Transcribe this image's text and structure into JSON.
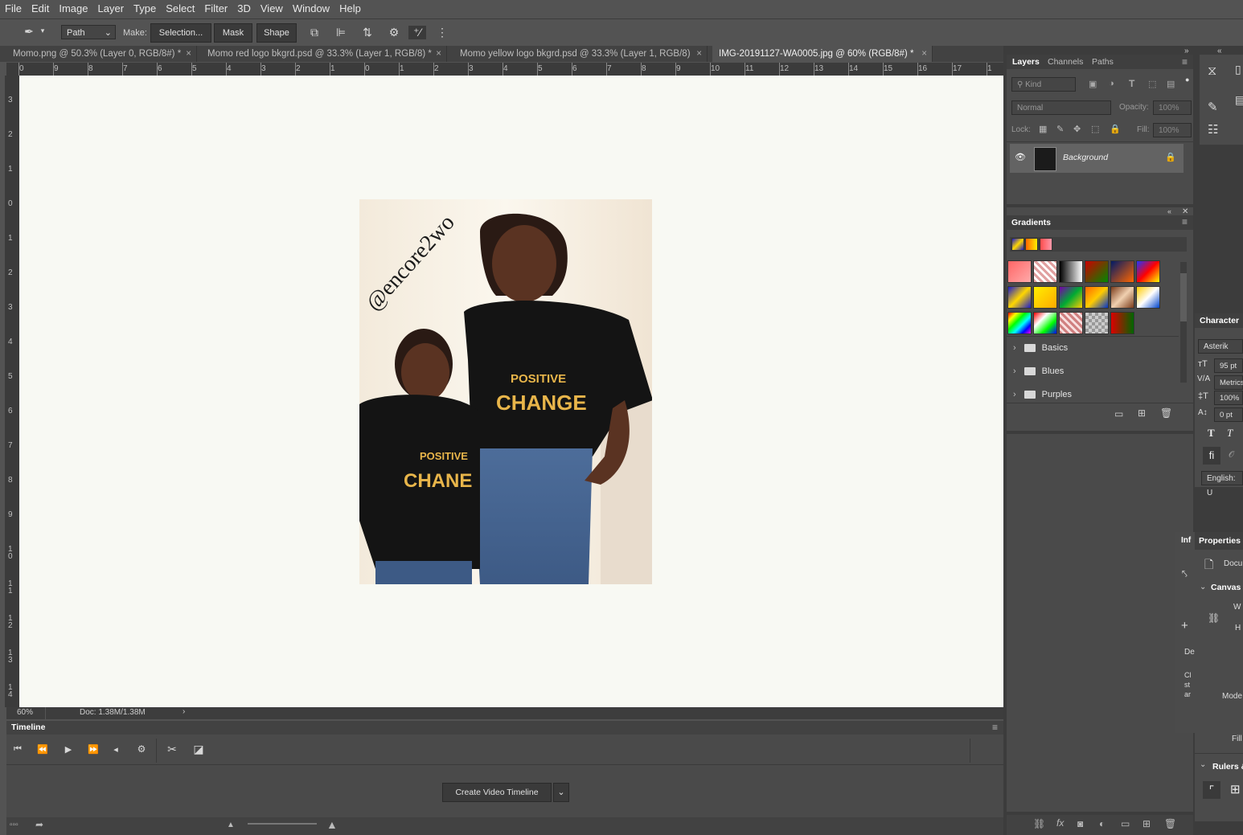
{
  "menu": [
    "File",
    "Edit",
    "Image",
    "Layer",
    "Type",
    "Select",
    "Filter",
    "3D",
    "View",
    "Window",
    "Help"
  ],
  "options": {
    "mode_value": "Path",
    "make_label": "Make:",
    "selection_button": "Selection...",
    "mask_button": "Mask",
    "shape_button": "Shape"
  },
  "tabs": [
    {
      "label": "Momo.png @ 50.3% (Layer 0, RGB/8#) *"
    },
    {
      "label": "Momo red logo bkgrd.psd @ 33.3% (Layer 1, RGB/8) *"
    },
    {
      "label": "Momo yellow logo bkgrd.psd @ 33.3% (Layer 1, RGB/8)"
    },
    {
      "label": "IMG-20191127-WA0005.jpg @ 60% (RGB/8#) *"
    }
  ],
  "ruler_h": [
    "0",
    "9",
    "8",
    "7",
    "6",
    "5",
    "4",
    "3",
    "2",
    "1",
    "0",
    "1",
    "2",
    "3",
    "4",
    "5",
    "6",
    "7",
    "8",
    "9",
    "10",
    "11",
    "12",
    "13",
    "14",
    "15",
    "16",
    "17",
    "1"
  ],
  "ruler_v": [
    "3",
    "2",
    "1",
    "0",
    "1",
    "2",
    "3",
    "4",
    "5",
    "6",
    "7",
    "8",
    "9",
    "1 0",
    "1 1",
    "1 2",
    "1 3",
    "1 4"
  ],
  "image": {
    "watermark": "@encore2wo",
    "shirt_text_1": "POSITIVE",
    "shirt_text_2": "CHANGE",
    "shirt_small_1": "POSITIVE",
    "shirt_small_2": "CHANE"
  },
  "status": {
    "zoom": "60%",
    "doc": "Doc: 1.38M/1.38M"
  },
  "timeline": {
    "title": "Timeline",
    "create_button": "Create Video Timeline"
  },
  "layers_panel": {
    "tabs": [
      "Layers",
      "Channels",
      "Paths"
    ],
    "kind_placeholder": "Kind",
    "blend_mode": "Normal",
    "opacity_label": "Opacity:",
    "opacity_value": "100%",
    "lock_label": "Lock:",
    "fill_label": "Fill:",
    "fill_value": "100%",
    "layer_name": "Background"
  },
  "gradients_panel": {
    "title": "Gradients",
    "folders": [
      "Basics",
      "Blues",
      "Purples"
    ]
  },
  "character_panel": {
    "title": "Character",
    "font": "Asterik",
    "size": "95 pt",
    "kerning": "Metrics",
    "vscale": "100%",
    "baseline": "0 pt",
    "language": "English: U"
  },
  "properties_panel": {
    "info_tab": "Inf",
    "title": "Properties",
    "doc_label": "Docu",
    "canvas_section": "Canvas",
    "w": "W",
    "h": "H",
    "mode": "Mode",
    "fill": "Fill",
    "rulers": "Rulers &",
    "side_text_1": "De",
    "side_text_2": "Cl",
    "side_text_3": "st",
    "side_text_4": "ar"
  },
  "colors": {
    "app_bg": "#535353",
    "panel_bg": "#4b4b4b",
    "canvas": "#f8f9f3",
    "accent_gold": "#e8b54a"
  }
}
